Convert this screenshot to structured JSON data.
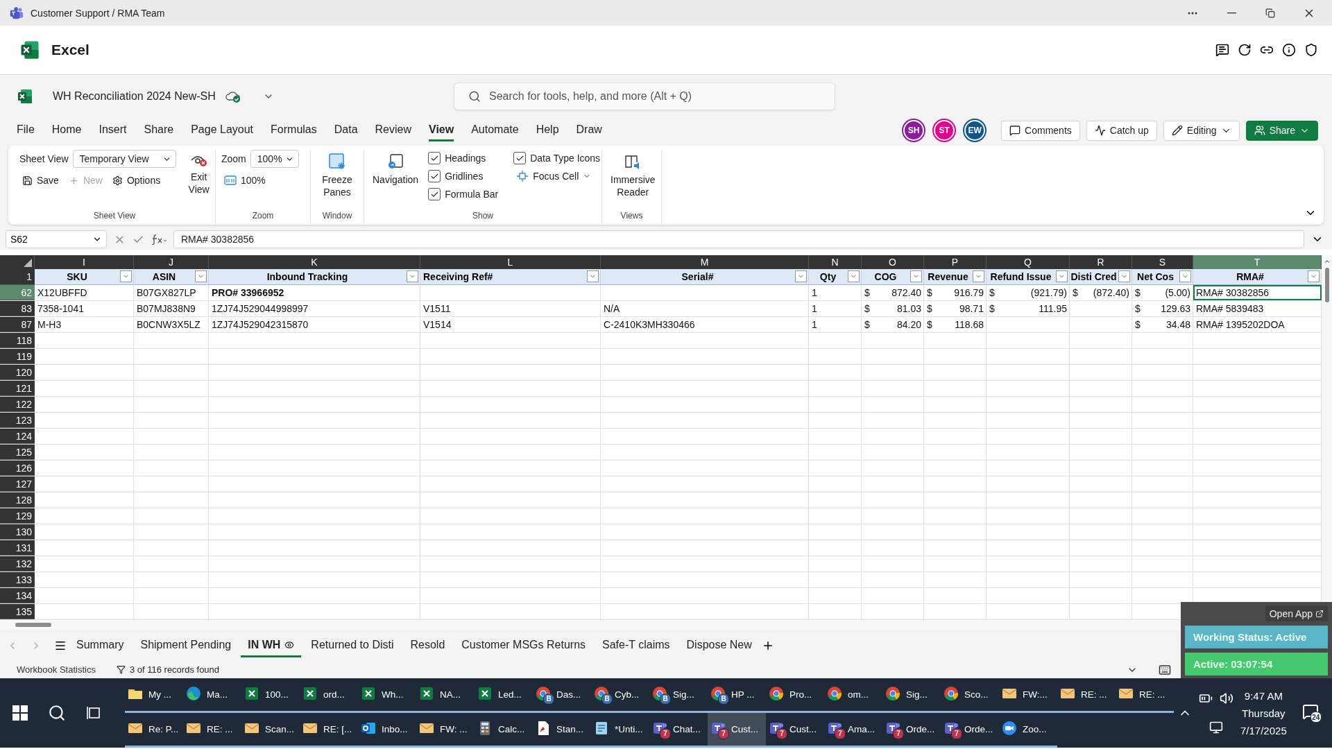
{
  "window": {
    "title": "Customer Support / RMA Team"
  },
  "app": {
    "name": "Excel"
  },
  "document": {
    "title": "WH Reconciliation 2024 New-SH",
    "saved": true
  },
  "search": {
    "placeholder": "Search for tools, help, and more (Alt + Q)"
  },
  "menu_tabs": [
    {
      "label": "File",
      "selected": false
    },
    {
      "label": "Home",
      "selected": false
    },
    {
      "label": "Insert",
      "selected": false
    },
    {
      "label": "Share",
      "selected": false
    },
    {
      "label": "Page Layout",
      "selected": false
    },
    {
      "label": "Formulas",
      "selected": false
    },
    {
      "label": "Data",
      "selected": false
    },
    {
      "label": "Review",
      "selected": false
    },
    {
      "label": "View",
      "selected": true
    },
    {
      "label": "Automate",
      "selected": false
    },
    {
      "label": "Help",
      "selected": false
    },
    {
      "label": "Draw",
      "selected": false
    }
  ],
  "collaborators": [
    {
      "initials": "SH",
      "color": "#8a1c9b"
    },
    {
      "initials": "ST",
      "color": "#e3008c"
    },
    {
      "initials": "EW",
      "color": "#0f548c"
    }
  ],
  "actions": [
    {
      "kind": "comments",
      "label": "Comments"
    },
    {
      "kind": "catchup",
      "label": "Catch up"
    },
    {
      "kind": "editing",
      "label": "Editing"
    },
    {
      "kind": "share",
      "label": "Share"
    }
  ],
  "ribbon": {
    "sheet_view": {
      "label": "Sheet View",
      "field_label": "Sheet View",
      "view": "Temporary View",
      "buttons": [
        {
          "kind": "save",
          "label": "Save",
          "disabled": false
        },
        {
          "kind": "new",
          "label": "New",
          "disabled": true
        },
        {
          "kind": "options",
          "label": "Options",
          "disabled": false
        }
      ],
      "exit": "Exit View"
    },
    "zoom": {
      "label": "Zoom",
      "field_label": "Zoom",
      "value": "100%",
      "reset": "100%"
    },
    "window": {
      "label": "Window",
      "freeze": "Freeze Panes"
    },
    "show": {
      "label": "Show",
      "navigation": "Navigation",
      "checks": [
        {
          "label": "Headings",
          "checked": true
        },
        {
          "label": "Gridlines",
          "checked": true
        },
        {
          "label": "Formula Bar",
          "checked": true
        },
        {
          "label": "Data Type Icons",
          "checked": true
        }
      ],
      "focus_cell": "Focus Cell"
    },
    "views": {
      "label": "Views",
      "reader": "Immersive Reader"
    }
  },
  "formula_bar": {
    "name_box": "S62",
    "formula": "RMA# 30382856"
  },
  "sheet": {
    "columns": [
      {
        "letter": "I",
        "header": "SKU",
        "selected": false
      },
      {
        "letter": "J",
        "header": "ASIN",
        "selected": false
      },
      {
        "letter": "K",
        "header": "Inbound Tracking",
        "selected": false
      },
      {
        "letter": "L",
        "header": "Receiving Ref#",
        "selected": false
      },
      {
        "letter": "M",
        "header": "Serial#",
        "selected": false
      },
      {
        "letter": "N",
        "header": "Qty",
        "selected": false
      },
      {
        "letter": "O",
        "header": "COG",
        "selected": false
      },
      {
        "letter": "P",
        "header": "Revenue",
        "selected": false
      },
      {
        "letter": "Q",
        "header": "Refund Issue",
        "selected": false
      },
      {
        "letter": "R",
        "header": "Disti Cred",
        "selected": false
      },
      {
        "letter": "S",
        "header": "Net Cos",
        "selected": false
      },
      {
        "letter": "T",
        "header": "RMA#",
        "selected": true
      }
    ],
    "header_row": "1",
    "rows": [
      {
        "number": "62",
        "selected": true,
        "cells": [
          {
            "text": "X12UBFFD"
          },
          {
            "text": "B07GX827LP"
          },
          {
            "text": "PRO# 33966952",
            "bold": true
          },
          null,
          null,
          {
            "text": "1"
          },
          {
            "currency": "$",
            "text": "872.40"
          },
          {
            "currency": "$",
            "text": "916.79"
          },
          {
            "currency": "$",
            "text": "(921.79)"
          },
          {
            "currency": "$",
            "text": "(872.40)"
          },
          {
            "currency": "$",
            "text": "(5.00)"
          },
          {
            "text": "RMA# 30382856",
            "active": true
          }
        ]
      },
      {
        "number": "83",
        "selected": false,
        "cells": [
          {
            "text": "7358-1041"
          },
          {
            "text": "B07MJ838N9"
          },
          {
            "text": "1ZJ74J529044998997"
          },
          {
            "text": "V1511"
          },
          {
            "text": "N/A"
          },
          {
            "text": "1"
          },
          {
            "currency": "$",
            "text": "81.03"
          },
          {
            "currency": "$",
            "text": "98.71"
          },
          {
            "currency": "$",
            "text": "111.95"
          },
          null,
          {
            "currency": "$",
            "text": "129.63"
          },
          {
            "text": "RMA# 5839483"
          }
        ]
      },
      {
        "number": "87",
        "selected": false,
        "cells": [
          {
            "text": "M-H3"
          },
          {
            "text": "B0CNW3X5LZ"
          },
          {
            "text": "1ZJ74J529042315870"
          },
          {
            "text": "V1514"
          },
          {
            "text": "C-2410K3MH330466"
          },
          {
            "text": "1"
          },
          {
            "currency": "$",
            "text": "84.20"
          },
          {
            "currency": "$",
            "text": "118.68"
          },
          null,
          null,
          {
            "currency": "$",
            "text": "34.48"
          },
          {
            "text": "RMA# 1395202DOA"
          }
        ]
      },
      {
        "number": "118",
        "selected": false
      },
      {
        "number": "119",
        "selected": false
      },
      {
        "number": "120",
        "selected": false
      },
      {
        "number": "121",
        "selected": false
      },
      {
        "number": "122",
        "selected": false
      },
      {
        "number": "123",
        "selected": false
      },
      {
        "number": "124",
        "selected": false
      },
      {
        "number": "125",
        "selected": false
      },
      {
        "number": "126",
        "selected": false
      },
      {
        "number": "127",
        "selected": false
      },
      {
        "number": "128",
        "selected": false
      },
      {
        "number": "129",
        "selected": false
      },
      {
        "number": "130",
        "selected": false
      },
      {
        "number": "131",
        "selected": false
      },
      {
        "number": "132",
        "selected": false
      },
      {
        "number": "133",
        "selected": false
      },
      {
        "number": "134",
        "selected": false
      },
      {
        "number": "135",
        "selected": false
      }
    ]
  },
  "sheet_tabs": [
    {
      "label": "Summary",
      "selected": false
    },
    {
      "label": "Shipment Pending",
      "selected": false
    },
    {
      "label": "IN WH",
      "selected": true
    },
    {
      "label": "Returned to Disti",
      "selected": false
    },
    {
      "label": "Resold",
      "selected": false
    },
    {
      "label": "Customer MSGs Returns",
      "selected": false
    },
    {
      "label": "Safe-T claims",
      "selected": false
    },
    {
      "label": "Dispose New",
      "selected": false
    }
  ],
  "status_bar": {
    "statistics": "Workbook Statistics",
    "records": "3 of 116 records found"
  },
  "tracker": {
    "open_app": "Open App",
    "status": "Working Status: Active",
    "timer": "Active: 03:07:54"
  },
  "taskbar": {
    "rows": [
      [
        {
          "kind": "folder",
          "label": "My ...",
          "selected": false
        },
        {
          "kind": "edge",
          "label": "Ma...",
          "selected": false
        },
        {
          "kind": "excel",
          "label": "100...",
          "selected": false
        },
        {
          "kind": "excel",
          "label": "ord...",
          "selected": false
        },
        {
          "kind": "excel",
          "label": "Wh...",
          "selected": false
        },
        {
          "kind": "excel",
          "label": "NA...",
          "selected": false
        },
        {
          "kind": "excel",
          "label": "Led...",
          "selected": false
        },
        {
          "kind": "chrome",
          "label": "Das...",
          "badge": "B",
          "selected": false
        },
        {
          "kind": "chrome",
          "label": "Cyb...",
          "badge": "B",
          "selected": false
        },
        {
          "kind": "chrome",
          "label": "Sig...",
          "badge": "B",
          "selected": false
        },
        {
          "kind": "chrome",
          "label": "HP ...",
          "badge": "B",
          "selected": false
        },
        {
          "kind": "chrome",
          "label": "Pro...",
          "selected": false
        },
        {
          "kind": "chrome",
          "label": "om...",
          "selected": false
        },
        {
          "kind": "chrome",
          "label": "Sig...",
          "selected": false
        },
        {
          "kind": "chrome",
          "label": "Sco...",
          "selected": false
        },
        {
          "kind": "mail",
          "label": "FW:...",
          "selected": false
        },
        {
          "kind": "mail",
          "label": "RE: ...",
          "selected": false
        },
        {
          "kind": "mail",
          "label": "RE: ...",
          "selected": false
        }
      ],
      [
        {
          "kind": "mail",
          "label": "Re: P...",
          "selected": false
        },
        {
          "kind": "mail",
          "label": "RE: ...",
          "selected": false
        },
        {
          "kind": "mail",
          "label": "Scan...",
          "selected": false
        },
        {
          "kind": "mail",
          "label": "RE: [...",
          "selected": false
        },
        {
          "kind": "outlook",
          "label": "Inbo...",
          "selected": false
        },
        {
          "kind": "mail",
          "label": "FW: ...",
          "selected": false
        },
        {
          "kind": "calc",
          "label": "Calc...",
          "selected": false
        },
        {
          "kind": "pdf",
          "label": "Stan...",
          "selected": false
        },
        {
          "kind": "notepad",
          "label": "*Unti...",
          "selected": false
        },
        {
          "kind": "teams",
          "label": "Chat...",
          "badge": "7",
          "selected": false
        },
        {
          "kind": "teams",
          "label": "Cust...",
          "badge": "7",
          "selected": true
        },
        {
          "kind": "teams",
          "label": "Cust...",
          "badge": "7",
          "selected": false
        },
        {
          "kind": "teams",
          "label": "Ama...",
          "badge": "7",
          "selected": false
        },
        {
          "kind": "teams",
          "label": "Orde...",
          "badge": "7",
          "selected": false
        },
        {
          "kind": "teams",
          "label": "Orde...",
          "badge": "7",
          "selected": false
        },
        {
          "kind": "zoom",
          "label": "Zoo...",
          "selected": false
        }
      ]
    ],
    "time": "9:47 AM",
    "day": "Thursday",
    "date": "7/17/2025",
    "notifications": "24"
  }
}
